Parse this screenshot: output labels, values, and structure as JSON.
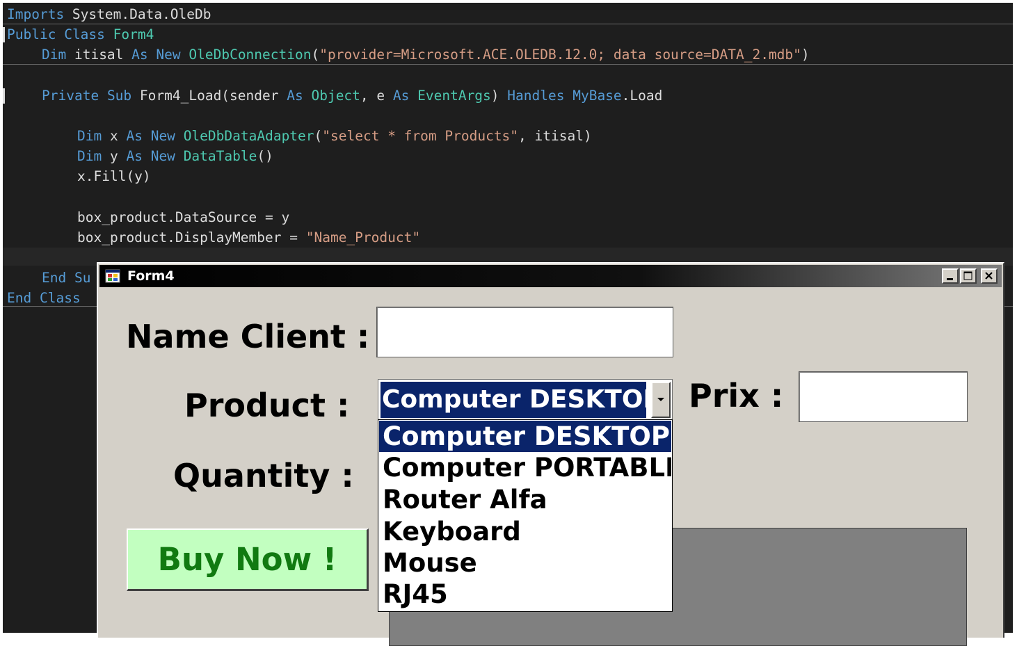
{
  "editor": {
    "line1": {
      "kw": "Imports",
      "rest": " System.Data.OleDb"
    },
    "line2": {
      "kw1": "Public",
      "kw2": "Class",
      "name": "Form4"
    },
    "line3": {
      "kw1": "Dim",
      "var": " itisal ",
      "kw2": "As",
      "kw3": "New",
      "type": "OleDbConnection",
      "open": "(",
      "str": "\"provider=Microsoft.ACE.OLEDB.12.0; data source=DATA_2.mdb\"",
      "close": ")"
    },
    "line4": {
      "kw1": "Private",
      "kw2": "Sub",
      "name": " Form4_Load(sender ",
      "kw3": "As",
      "type1": "Object",
      "mid": ", e ",
      "kw4": "As",
      "type2": "EventArgs",
      "close": ") ",
      "kw5": "Handles",
      "kw6": "MyBase",
      "tail": ".Load"
    },
    "line5": {
      "kw1": "Dim",
      "var": " x ",
      "kw2": "As",
      "kw3": "New",
      "type": "OleDbDataAdapter",
      "open": "(",
      "str": "\"select * from Products\"",
      "tail": ", itisal)"
    },
    "line6": {
      "kw1": "Dim",
      "var": " y ",
      "kw2": "As",
      "kw3": "New",
      "type": "DataTable",
      "tail": "()"
    },
    "line7": "x.Fill(y)",
    "line8": "box_product.DataSource = y",
    "line9": {
      "pre": "box_product.DisplayMember = ",
      "str": "\"Name_Product\""
    },
    "line10": {
      "kw1": "End",
      "kw2": "Su"
    },
    "line11": {
      "kw1": "End",
      "kw2": "Class"
    }
  },
  "window": {
    "title": "Form4",
    "controls": {
      "minimize": "minimize",
      "maximize": "maximize",
      "close": "close"
    }
  },
  "form": {
    "name_client_label": "Name Client :",
    "name_client_value": "",
    "product_label": "Product :",
    "product_selected": "Computer DESKTOP",
    "prix_label": "Prix :",
    "prix_value": "",
    "quantity_label": "Quantity :",
    "buy_button": "Buy Now !",
    "products": [
      "Computer DESKTOP",
      "Computer PORTABLE",
      "Router Alfa",
      "Keyboard",
      "Mouse",
      "RJ45"
    ]
  },
  "colors": {
    "editor_bg": "#1e1e1e",
    "keyword": "#569cd6",
    "type": "#4ec9b0",
    "string": "#d69d85",
    "selection": "#0a246a",
    "buy_button_bg": "#c2ffc0",
    "buy_button_text": "#117a11"
  },
  "icons": [
    "form-app-icon",
    "minimize-icon",
    "maximize-icon",
    "close-icon",
    "dropdown-arrow-icon"
  ]
}
